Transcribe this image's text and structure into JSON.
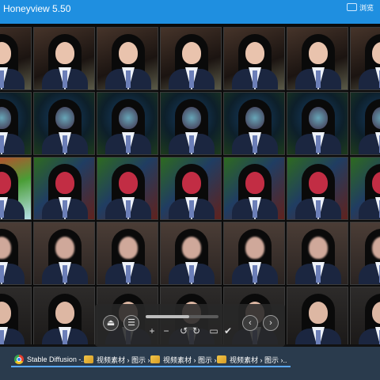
{
  "window": {
    "title": "Honeyview 5.50",
    "browse_label": "浏览",
    "accent": "#1f8fe0"
  },
  "viewer": {
    "grid_rows": 5,
    "grid_cols": 6,
    "icon_names": [
      "eject-icon",
      "menu-icon",
      "zoom-in-icon",
      "zoom-out-icon",
      "rotate-left-icon",
      "rotate-right-icon",
      "slider-icon",
      "check-icon",
      "previous-icon",
      "next-icon"
    ]
  },
  "taskbar": {
    "items": [
      {
        "label": "Stable Diffusion -..",
        "icon": "chrome-icon"
      },
      {
        "label": "视频素材 › 图示 ›..",
        "icon": "folder-icon"
      },
      {
        "label": "视频素材 › 图示 ›..",
        "icon": "folder-icon"
      },
      {
        "label": "视频素材 › 图示 ›..",
        "icon": "folder-icon"
      }
    ]
  }
}
